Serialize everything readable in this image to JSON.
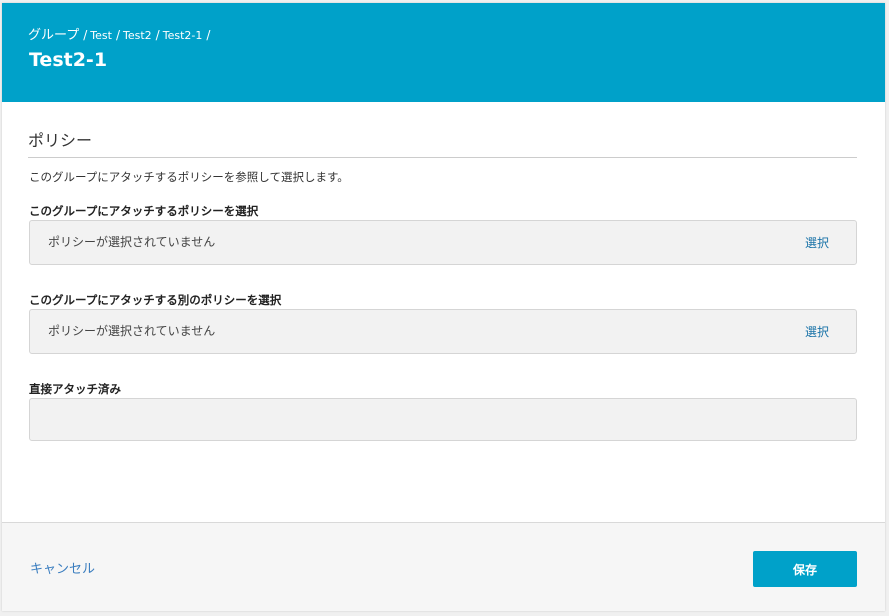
{
  "header": {
    "breadcrumb": {
      "root": "グループ",
      "items": [
        "Test",
        "Test2",
        "Test2-1"
      ],
      "separator": "/"
    },
    "title": "Test2-1",
    "color": "#00a1c9"
  },
  "section": {
    "title": "ポリシー",
    "description": "このグループにアタッチするポリシーを参照して選択します。"
  },
  "fields": [
    {
      "label": "このグループにアタッチするポリシーを選択",
      "value": "ポリシーが選択されていません",
      "action": "選択"
    },
    {
      "label": "このグループにアタッチする別のポリシーを選択",
      "value": "ポリシーが選択されていません",
      "action": "選択"
    },
    {
      "label": "直接アタッチ済み",
      "value": ""
    }
  ],
  "footer": {
    "cancel_label": "キャンセル",
    "save_label": "保存"
  }
}
